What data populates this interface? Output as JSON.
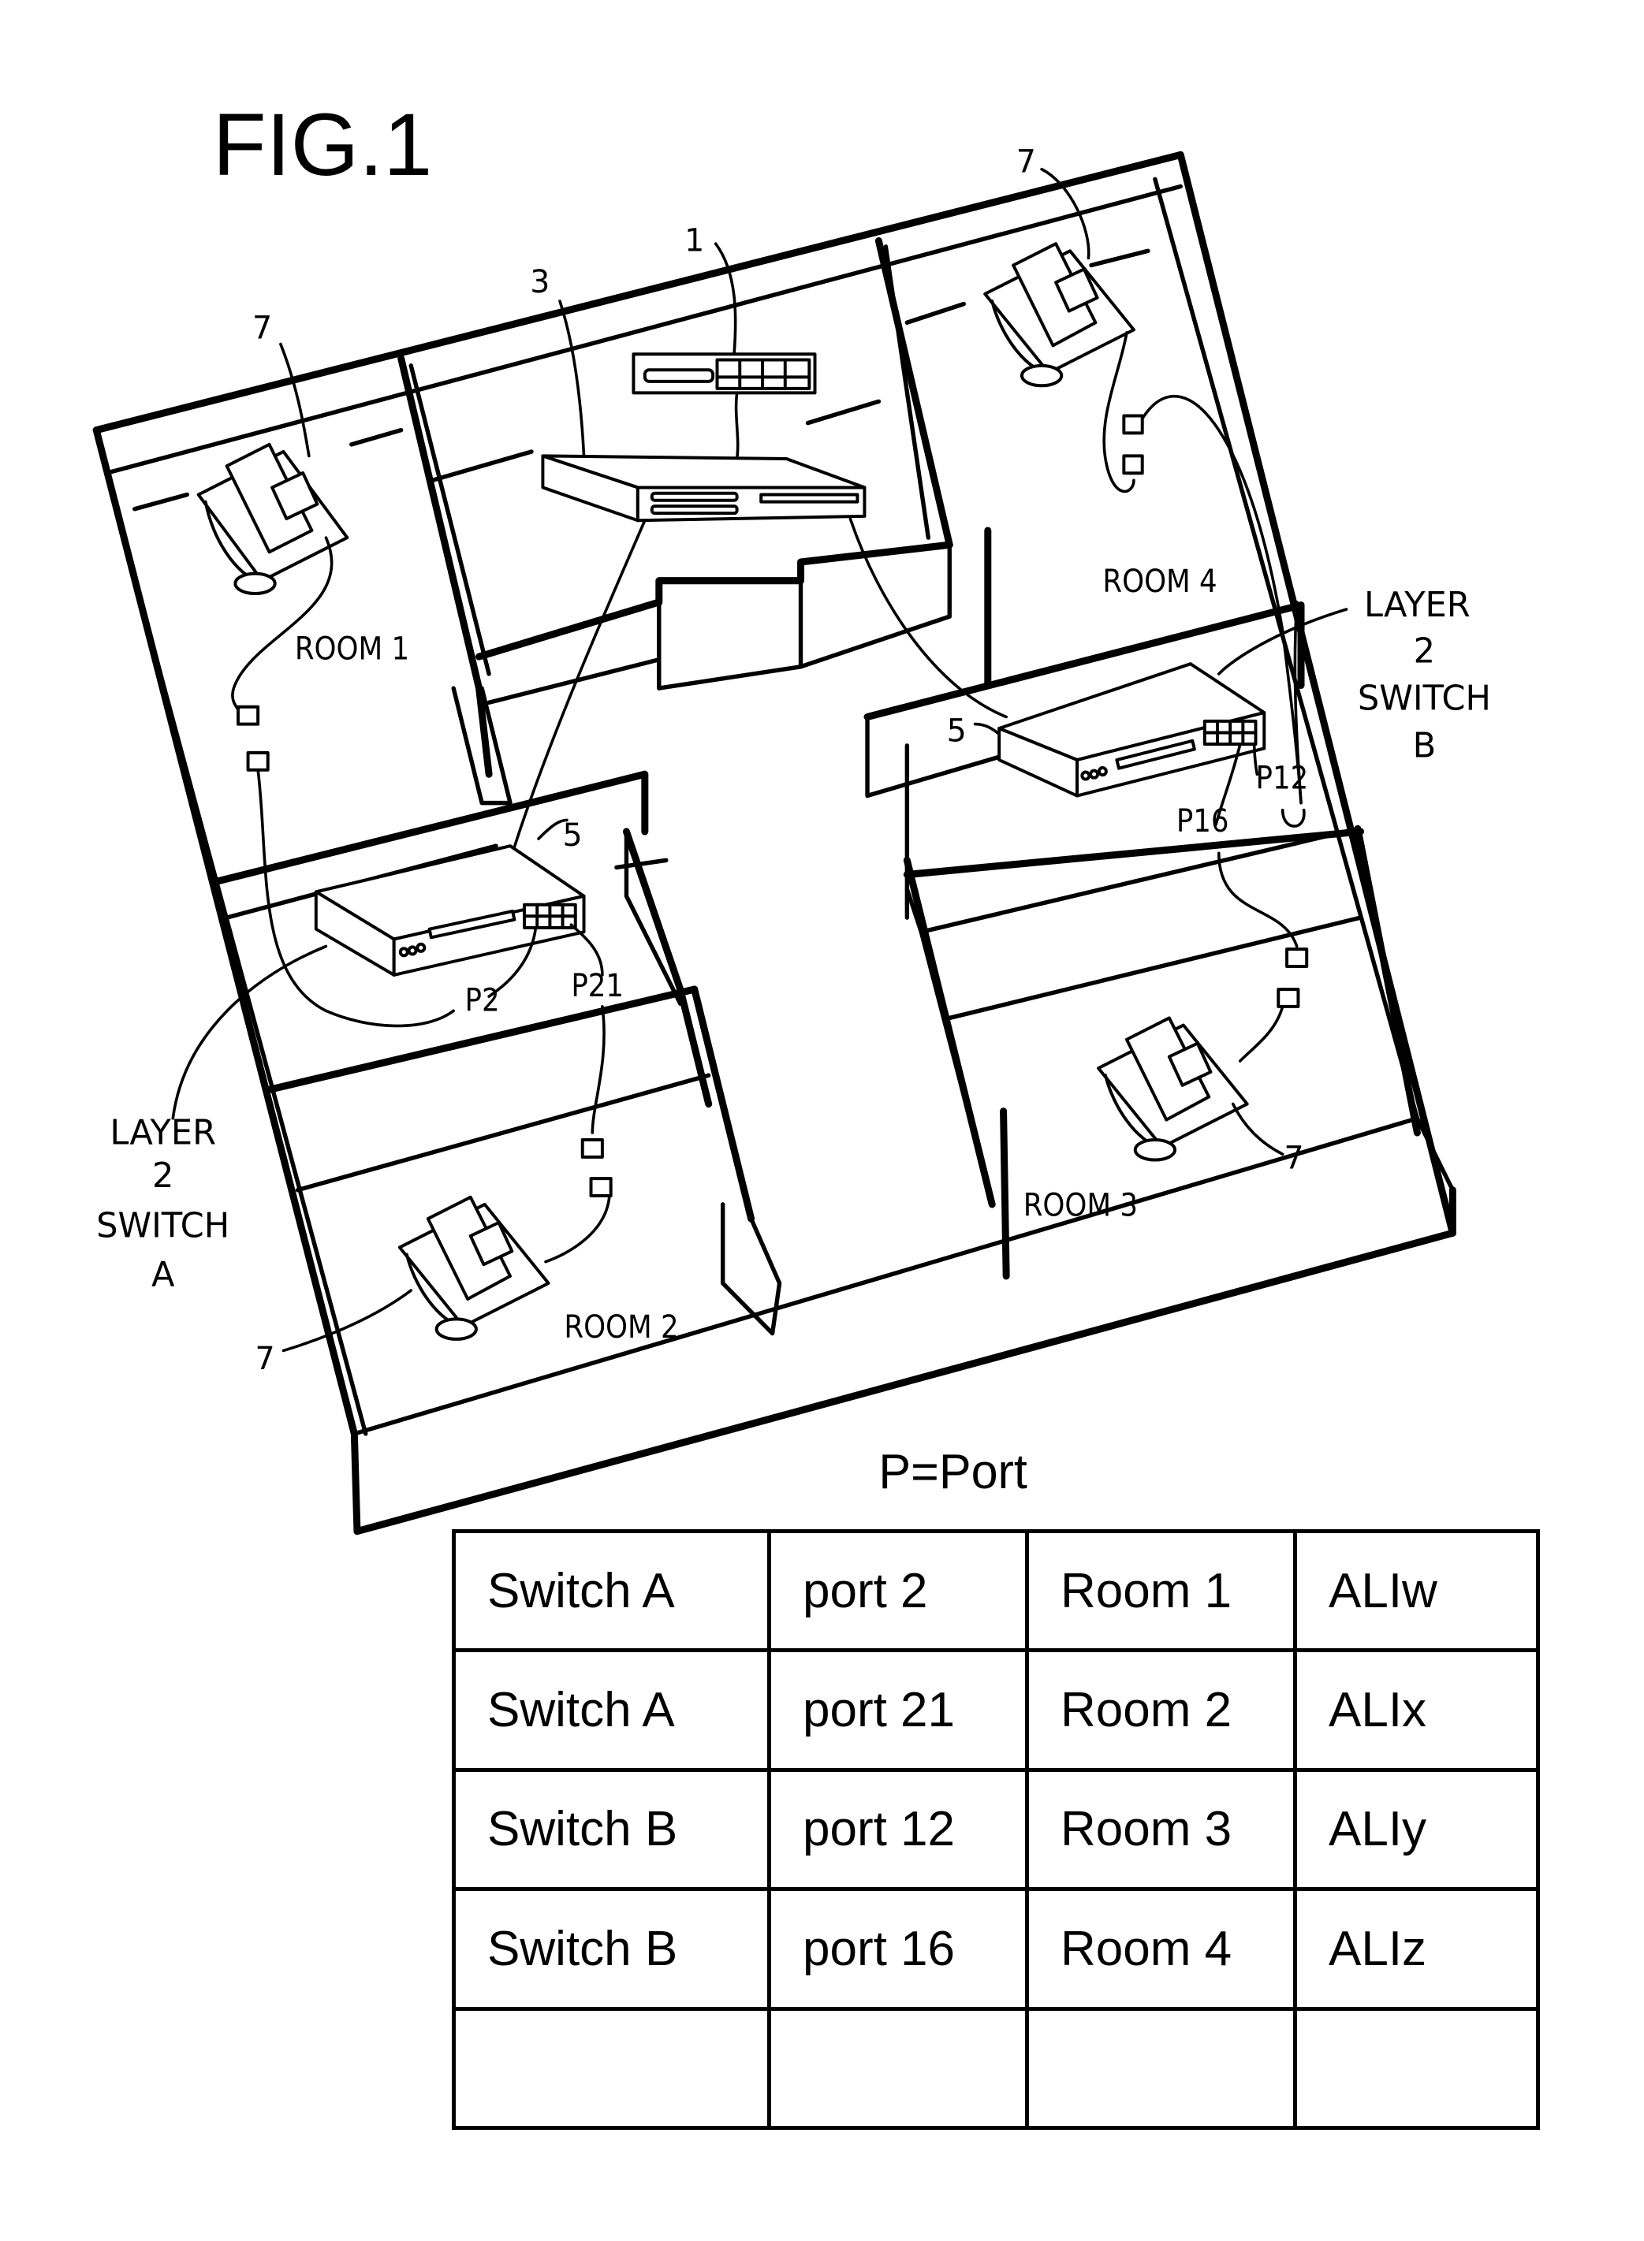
{
  "figure": {
    "title": "FIG.1",
    "legend": "P=Port"
  },
  "rooms": [
    {
      "id": "room-1",
      "label": "ROOM 1"
    },
    {
      "id": "room-2",
      "label": "ROOM 2"
    },
    {
      "id": "room-3",
      "label": "ROOM 3"
    },
    {
      "id": "room-4",
      "label": "ROOM 4"
    }
  ],
  "reference_numerals": {
    "router": "1",
    "main_switch": "3",
    "layer2_switch": "5",
    "telephone": "7"
  },
  "switch_labels": {
    "a": {
      "line1": "LAYER",
      "line2": "2",
      "line3": "SWITCH",
      "line4": "A"
    },
    "b": {
      "line1": "LAYER",
      "line2": "2",
      "line3": "SWITCH",
      "line4": "B"
    }
  },
  "port_labels": {
    "p2": "P2",
    "p21": "P21",
    "p12": "P12",
    "p16": "P16"
  },
  "table": {
    "rows": [
      [
        "Switch A",
        "port 2",
        "Room 1",
        "ALIw"
      ],
      [
        "Switch A",
        "port 21",
        "Room 2",
        "ALIx"
      ],
      [
        "Switch B",
        "port 12",
        "Room 3",
        "ALIy"
      ],
      [
        "Switch B",
        "port 16",
        "Room 4",
        "ALIz"
      ],
      [
        "",
        "",
        "",
        ""
      ]
    ]
  }
}
